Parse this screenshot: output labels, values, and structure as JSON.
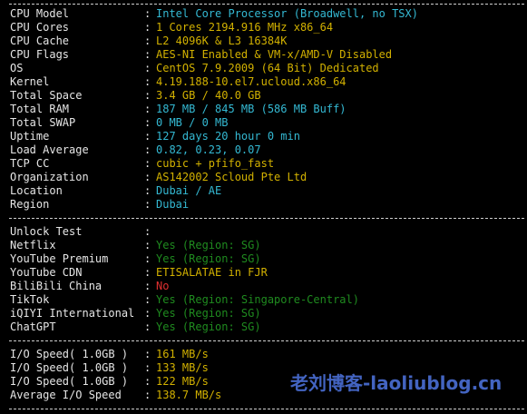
{
  "window": {
    "title": ""
  },
  "system": [
    {
      "label": "CPU Model",
      "value": "Intel Core Processor (Broadwell, no TSX)",
      "color": "cyan"
    },
    {
      "label": "CPU Cores",
      "value": "1 Cores 2194.916 MHz x86_64",
      "color": "yellow"
    },
    {
      "label": "CPU Cache",
      "value": "L2 4096K & L3 16384K",
      "color": "yellow"
    },
    {
      "label": "CPU Flags",
      "value": "AES-NI Enabled & VM-x/AMD-V Disabled",
      "color": "yellow"
    },
    {
      "label": "OS",
      "value": "CentOS 7.9.2009 (64 Bit) Dedicated",
      "color": "yellow"
    },
    {
      "label": "Kernel",
      "value": "4.19.188-10.el7.ucloud.x86_64",
      "color": "yellow"
    },
    {
      "label": "Total Space",
      "value": "3.4 GB / 40.0 GB",
      "color": "yellow"
    },
    {
      "label": "Total RAM",
      "value": "187 MB / 845 MB (586 MB Buff)",
      "color": "cyan"
    },
    {
      "label": "Total SWAP",
      "value": "0 MB / 0 MB",
      "color": "cyan"
    },
    {
      "label": "Uptime",
      "value": "127 days 20 hour 0 min",
      "color": "cyan"
    },
    {
      "label": "Load Average",
      "value": "0.82, 0.23, 0.07",
      "color": "cyan"
    },
    {
      "label": "TCP CC",
      "value": "cubic + pfifo_fast",
      "color": "yellow"
    },
    {
      "label": "Organization",
      "value": "AS142002 Scloud Pte Ltd",
      "color": "yellow"
    },
    {
      "label": "Location",
      "value": "Dubai / AE",
      "color": "cyan"
    },
    {
      "label": "Region",
      "value": "Dubai",
      "color": "cyan"
    }
  ],
  "unlock": [
    {
      "label": "Unlock Test",
      "value": "",
      "color": "white"
    },
    {
      "label": "Netflix",
      "value": "Yes (Region: SG)",
      "color": "green"
    },
    {
      "label": "YouTube Premium",
      "value": "Yes (Region: SG)",
      "color": "green"
    },
    {
      "label": "YouTube CDN",
      "value": "ETISALATAE in FJR",
      "color": "yellow"
    },
    {
      "label": "BiliBili China",
      "value": "No",
      "color": "red"
    },
    {
      "label": "TikTok",
      "value": "Yes (Region: Singapore-Central)",
      "color": "green"
    },
    {
      "label": "iQIYI International",
      "value": "Yes (Region: SG)",
      "color": "green"
    },
    {
      "label": "ChatGPT",
      "value": "Yes (Region: SG)",
      "color": "green"
    }
  ],
  "io": [
    {
      "label": "I/O Speed( 1.0GB )",
      "value": "161 MB/s",
      "color": "yellow"
    },
    {
      "label": "I/O Speed( 1.0GB )",
      "value": "133 MB/s",
      "color": "yellow"
    },
    {
      "label": "I/O Speed( 1.0GB )",
      "value": "122 MB/s",
      "color": "yellow"
    },
    {
      "label": "Average I/O Speed",
      "value": "138.7 MB/s",
      "color": "yellow"
    }
  ],
  "separator": ":",
  "watermark": "老刘博客-laoliublog.cn",
  "colors": {
    "background": "#000000",
    "label": "#e6e6e6",
    "cyan": "#34b9d3",
    "yellow": "#d2b100",
    "green": "#1f8b1f",
    "red": "#e03030",
    "watermark": "#4b6fd6"
  }
}
